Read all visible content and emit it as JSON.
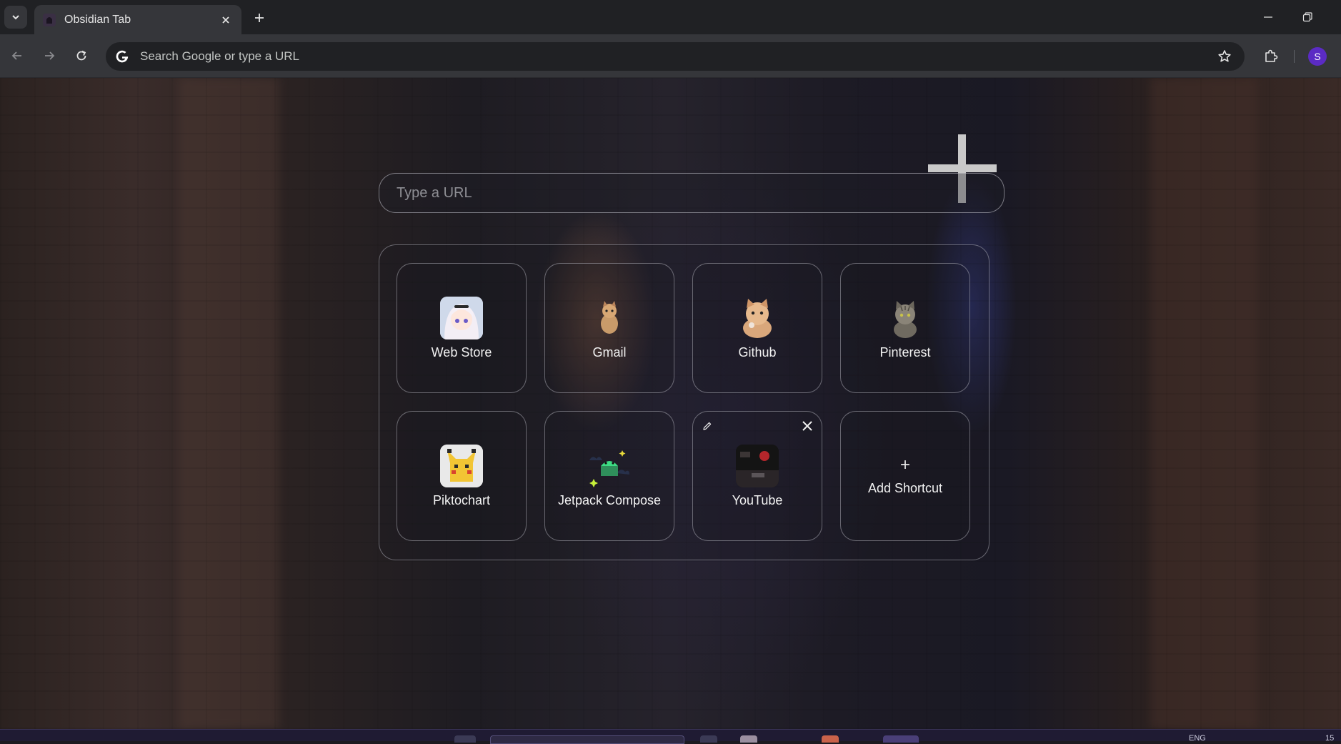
{
  "browser": {
    "tab_title": "Obsidian Tab",
    "omnibox_placeholder": "Search Google or type a URL",
    "profile_initial": "S"
  },
  "page": {
    "url_input_placeholder": "Type a URL",
    "shortcuts": [
      {
        "label": "Web Store",
        "icon": "anime-girl-icon"
      },
      {
        "label": "Gmail",
        "icon": "small-cat-icon"
      },
      {
        "label": "Github",
        "icon": "orange-cat-icon"
      },
      {
        "label": "Pinterest",
        "icon": "tabby-cat-icon"
      },
      {
        "label": "Piktochart",
        "icon": "pikachu-icon"
      },
      {
        "label": "Jetpack Compose",
        "icon": "android-sparkles-icon"
      },
      {
        "label": "YouTube",
        "icon": "dark-scene-icon"
      }
    ],
    "add_shortcut_label": "Add Shortcut"
  },
  "taskbar": {
    "lang": "ENG",
    "clock_partial": "15"
  },
  "colors": {
    "chrome_dark": "#202124",
    "chrome_toolbar": "#35363a",
    "avatar": "#5b2bc4",
    "tile_border": "#c8c8d2"
  }
}
